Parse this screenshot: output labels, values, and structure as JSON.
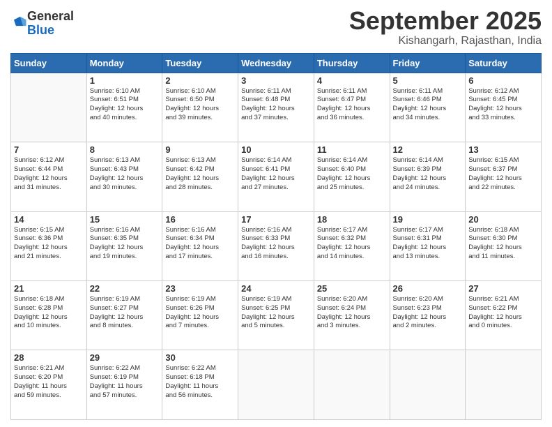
{
  "logo": {
    "general": "General",
    "blue": "Blue"
  },
  "title": "September 2025",
  "subtitle": "Kishangarh, Rajasthan, India",
  "weekdays": [
    "Sunday",
    "Monday",
    "Tuesday",
    "Wednesday",
    "Thursday",
    "Friday",
    "Saturday"
  ],
  "weeks": [
    [
      {
        "day": "",
        "info": ""
      },
      {
        "day": "1",
        "info": "Sunrise: 6:10 AM\nSunset: 6:51 PM\nDaylight: 12 hours\nand 40 minutes."
      },
      {
        "day": "2",
        "info": "Sunrise: 6:10 AM\nSunset: 6:50 PM\nDaylight: 12 hours\nand 39 minutes."
      },
      {
        "day": "3",
        "info": "Sunrise: 6:11 AM\nSunset: 6:48 PM\nDaylight: 12 hours\nand 37 minutes."
      },
      {
        "day": "4",
        "info": "Sunrise: 6:11 AM\nSunset: 6:47 PM\nDaylight: 12 hours\nand 36 minutes."
      },
      {
        "day": "5",
        "info": "Sunrise: 6:11 AM\nSunset: 6:46 PM\nDaylight: 12 hours\nand 34 minutes."
      },
      {
        "day": "6",
        "info": "Sunrise: 6:12 AM\nSunset: 6:45 PM\nDaylight: 12 hours\nand 33 minutes."
      }
    ],
    [
      {
        "day": "7",
        "info": "Sunrise: 6:12 AM\nSunset: 6:44 PM\nDaylight: 12 hours\nand 31 minutes."
      },
      {
        "day": "8",
        "info": "Sunrise: 6:13 AM\nSunset: 6:43 PM\nDaylight: 12 hours\nand 30 minutes."
      },
      {
        "day": "9",
        "info": "Sunrise: 6:13 AM\nSunset: 6:42 PM\nDaylight: 12 hours\nand 28 minutes."
      },
      {
        "day": "10",
        "info": "Sunrise: 6:14 AM\nSunset: 6:41 PM\nDaylight: 12 hours\nand 27 minutes."
      },
      {
        "day": "11",
        "info": "Sunrise: 6:14 AM\nSunset: 6:40 PM\nDaylight: 12 hours\nand 25 minutes."
      },
      {
        "day": "12",
        "info": "Sunrise: 6:14 AM\nSunset: 6:39 PM\nDaylight: 12 hours\nand 24 minutes."
      },
      {
        "day": "13",
        "info": "Sunrise: 6:15 AM\nSunset: 6:37 PM\nDaylight: 12 hours\nand 22 minutes."
      }
    ],
    [
      {
        "day": "14",
        "info": "Sunrise: 6:15 AM\nSunset: 6:36 PM\nDaylight: 12 hours\nand 21 minutes."
      },
      {
        "day": "15",
        "info": "Sunrise: 6:16 AM\nSunset: 6:35 PM\nDaylight: 12 hours\nand 19 minutes."
      },
      {
        "day": "16",
        "info": "Sunrise: 6:16 AM\nSunset: 6:34 PM\nDaylight: 12 hours\nand 17 minutes."
      },
      {
        "day": "17",
        "info": "Sunrise: 6:16 AM\nSunset: 6:33 PM\nDaylight: 12 hours\nand 16 minutes."
      },
      {
        "day": "18",
        "info": "Sunrise: 6:17 AM\nSunset: 6:32 PM\nDaylight: 12 hours\nand 14 minutes."
      },
      {
        "day": "19",
        "info": "Sunrise: 6:17 AM\nSunset: 6:31 PM\nDaylight: 12 hours\nand 13 minutes."
      },
      {
        "day": "20",
        "info": "Sunrise: 6:18 AM\nSunset: 6:30 PM\nDaylight: 12 hours\nand 11 minutes."
      }
    ],
    [
      {
        "day": "21",
        "info": "Sunrise: 6:18 AM\nSunset: 6:28 PM\nDaylight: 12 hours\nand 10 minutes."
      },
      {
        "day": "22",
        "info": "Sunrise: 6:19 AM\nSunset: 6:27 PM\nDaylight: 12 hours\nand 8 minutes."
      },
      {
        "day": "23",
        "info": "Sunrise: 6:19 AM\nSunset: 6:26 PM\nDaylight: 12 hours\nand 7 minutes."
      },
      {
        "day": "24",
        "info": "Sunrise: 6:19 AM\nSunset: 6:25 PM\nDaylight: 12 hours\nand 5 minutes."
      },
      {
        "day": "25",
        "info": "Sunrise: 6:20 AM\nSunset: 6:24 PM\nDaylight: 12 hours\nand 3 minutes."
      },
      {
        "day": "26",
        "info": "Sunrise: 6:20 AM\nSunset: 6:23 PM\nDaylight: 12 hours\nand 2 minutes."
      },
      {
        "day": "27",
        "info": "Sunrise: 6:21 AM\nSunset: 6:22 PM\nDaylight: 12 hours\nand 0 minutes."
      }
    ],
    [
      {
        "day": "28",
        "info": "Sunrise: 6:21 AM\nSunset: 6:20 PM\nDaylight: 11 hours\nand 59 minutes."
      },
      {
        "day": "29",
        "info": "Sunrise: 6:22 AM\nSunset: 6:19 PM\nDaylight: 11 hours\nand 57 minutes."
      },
      {
        "day": "30",
        "info": "Sunrise: 6:22 AM\nSunset: 6:18 PM\nDaylight: 11 hours\nand 56 minutes."
      },
      {
        "day": "",
        "info": ""
      },
      {
        "day": "",
        "info": ""
      },
      {
        "day": "",
        "info": ""
      },
      {
        "day": "",
        "info": ""
      }
    ]
  ]
}
